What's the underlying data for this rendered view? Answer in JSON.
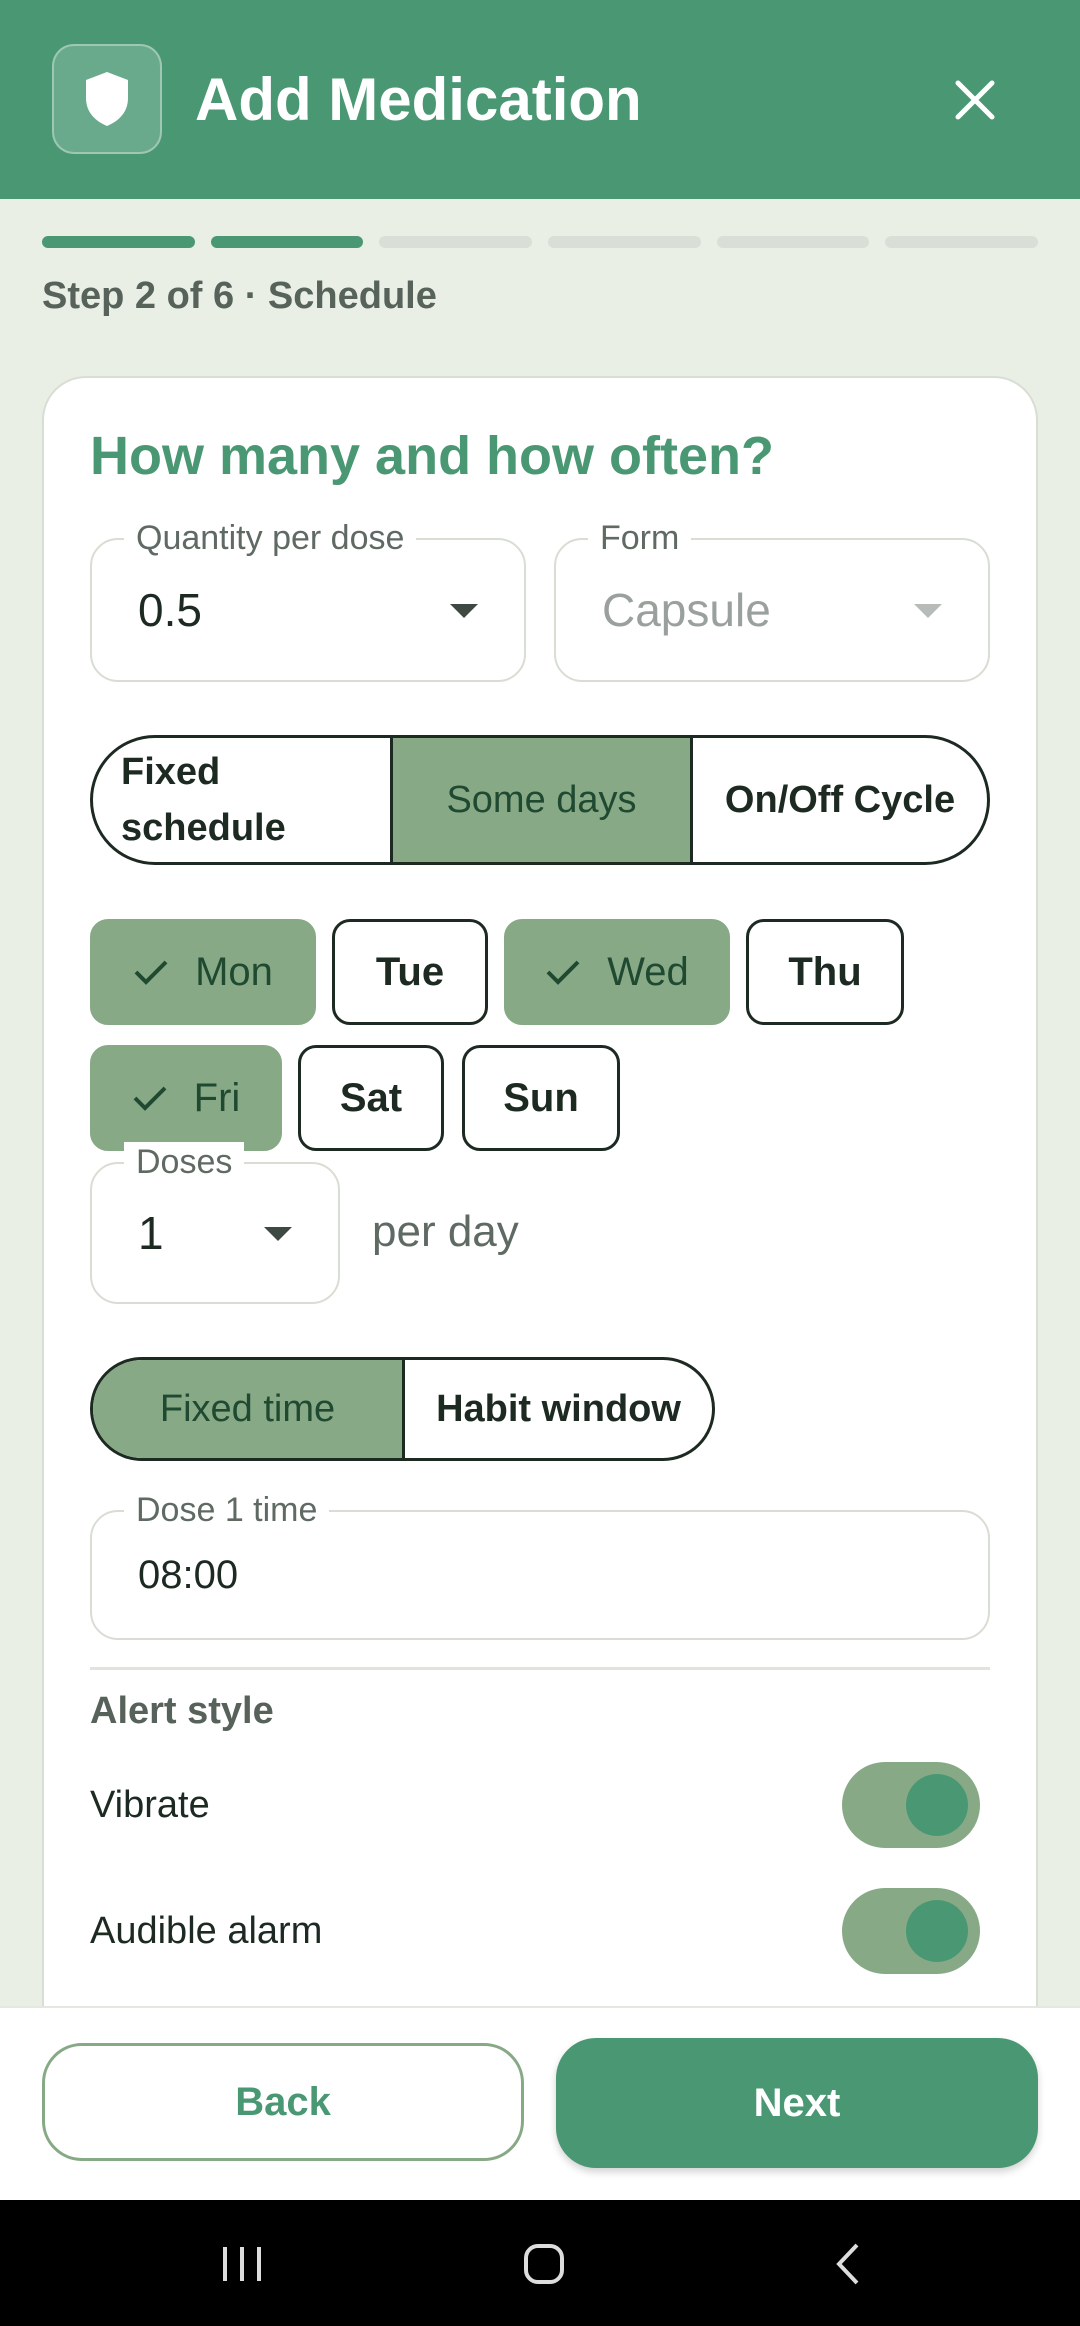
{
  "header": {
    "title": "Add Medication",
    "app_icon": "shield-icon",
    "close_icon": "close-icon"
  },
  "progress": {
    "total_steps": 6,
    "completed_steps": 2,
    "label": "Step 2 of 6 · Schedule"
  },
  "card": {
    "title": "How many and how often?",
    "quantity": {
      "label": "Quantity per dose",
      "value": "0.5"
    },
    "form": {
      "label": "Form",
      "value": "Capsule"
    },
    "schedule_type": {
      "options": [
        "Fixed schedule",
        "Some days",
        "On/Off Cycle"
      ],
      "selected": "Some days"
    },
    "days": [
      {
        "label": "Mon",
        "selected": true
      },
      {
        "label": "Tue",
        "selected": false
      },
      {
        "label": "Wed",
        "selected": true
      },
      {
        "label": "Thu",
        "selected": false
      },
      {
        "label": "Fri",
        "selected": true
      },
      {
        "label": "Sat",
        "selected": false
      },
      {
        "label": "Sun",
        "selected": false
      }
    ],
    "doses": {
      "label": "Doses",
      "value": "1",
      "suffix": "per day"
    },
    "time_mode": {
      "options": [
        "Fixed time",
        "Habit window"
      ],
      "selected": "Fixed time"
    },
    "dose_time": {
      "label": "Dose 1 time",
      "value": "08:00"
    },
    "alerts": {
      "section_label": "Alert style",
      "items": [
        {
          "label": "Vibrate",
          "on": true
        },
        {
          "label": "Audible alarm",
          "on": true
        }
      ]
    }
  },
  "footer": {
    "back_label": "Back",
    "next_label": "Next"
  },
  "colors": {
    "primary": "#4a9873",
    "selected_fill": "#87a986",
    "background": "#e9efe5"
  }
}
